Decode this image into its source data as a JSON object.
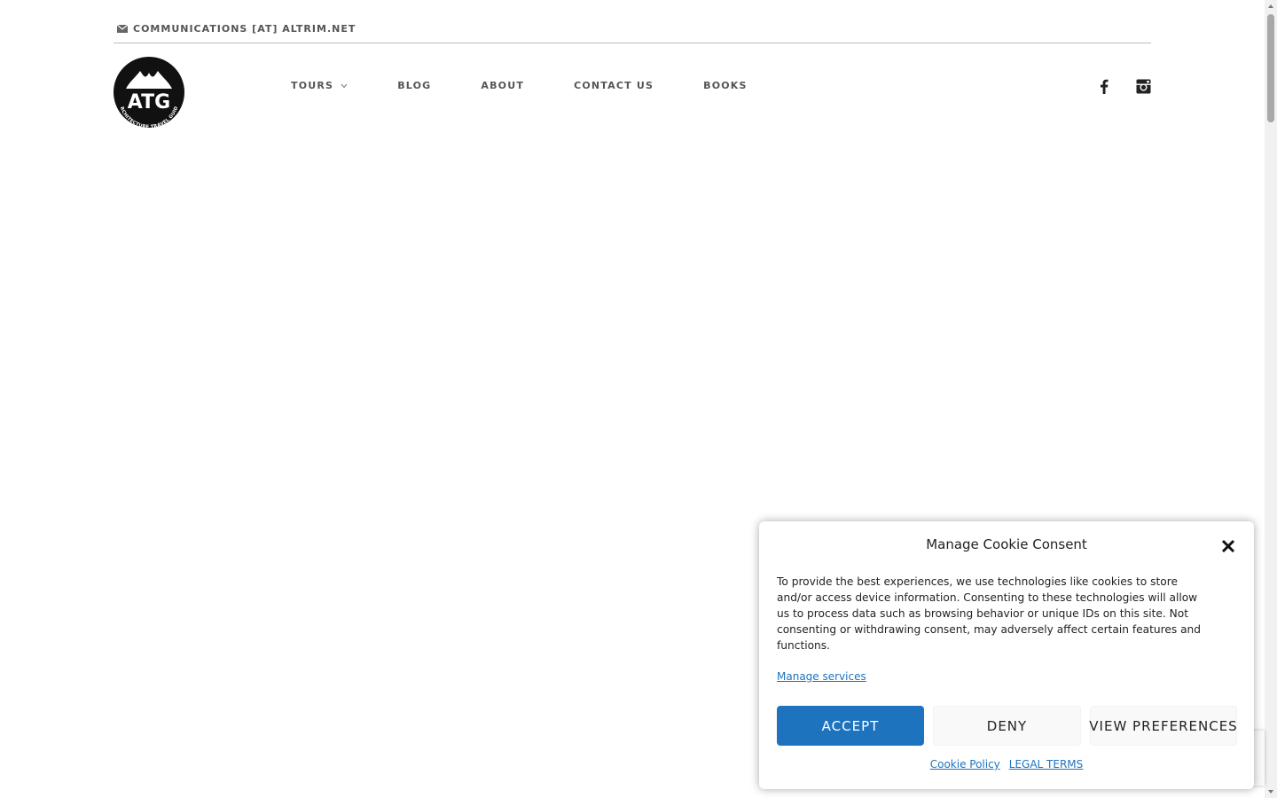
{
  "topbar": {
    "email": "COMMUNICATIONS [AT] ALTRIM.NET",
    "mail_icon": "envelope-icon"
  },
  "logo": {
    "text": "ATG",
    "tagline": "ARCHITECTURE TRAVEL GUIDE"
  },
  "nav": {
    "items": [
      {
        "label": "TOURS",
        "has_dropdown": true
      },
      {
        "label": "BLOG"
      },
      {
        "label": "ABOUT"
      },
      {
        "label": "CONTACT US"
      },
      {
        "label": "BOOKS"
      }
    ]
  },
  "socials": [
    "facebook-icon",
    "instagram-icon"
  ],
  "cookie": {
    "title": "Manage Cookie Consent",
    "body": "To provide the best experiences, we use technologies like cookies to store and/or access device information. Consenting to these technologies will allow us to process data such as browsing behavior or unique IDs on this site. Not consenting or withdrawing consent, may adversely affect certain features and functions.",
    "manage_link": "Manage services",
    "accept_label": "ACCEPT",
    "deny_label": "DENY",
    "prefs_label": "VIEW PREFERENCES",
    "cookie_policy_label": "Cookie Policy",
    "legal_terms_label": "LEGAL TERMS"
  },
  "colors": {
    "accent": "#1e73be",
    "nav_text": "#555555",
    "divider": "#bdbdbd"
  }
}
